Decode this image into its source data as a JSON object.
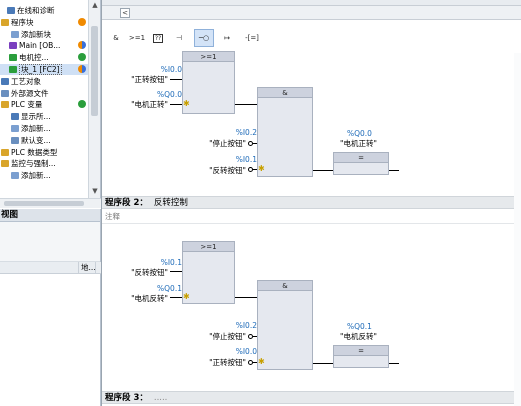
{
  "tree": {
    "items": [
      {
        "label": "在线和诊断",
        "icon": "diagnostics-icon",
        "indent": 6,
        "color": "#4a7ab8"
      },
      {
        "label": "程序块",
        "icon": "folder-icon",
        "indent": 0,
        "color": "#d9a52b",
        "status": "#f08a00"
      },
      {
        "label": "添加新块",
        "icon": "add-block-icon",
        "indent": 10,
        "color": "#7b9fd0"
      },
      {
        "label": "Main [OB...",
        "icon": "ob-block-icon",
        "indent": 8,
        "color": "#7a3fbf",
        "status": "split"
      },
      {
        "label": "电机控...",
        "icon": "fb-block-icon",
        "indent": 8,
        "color": "#2a9e3c",
        "status": "#2a9e3c"
      },
      {
        "label": "块_1 [FC2]",
        "icon": "fc-block-icon",
        "indent": 8,
        "color": "#2a9e3c",
        "status": "split",
        "selected": true
      },
      {
        "label": "工艺对象",
        "icon": "technology-icon",
        "indent": 0,
        "color": "#4a7ab8"
      },
      {
        "label": "外部源文件",
        "icon": "source-file-icon",
        "indent": 0,
        "color": "#6a8fbf"
      },
      {
        "label": "PLC 变量",
        "icon": "tag-table-icon",
        "indent": 0,
        "color": "#d9a52b",
        "status": "#2a9e3c"
      },
      {
        "label": "显示所...",
        "icon": "show-all-icon",
        "indent": 10,
        "color": "#4a7ab8"
      },
      {
        "label": "添加新...",
        "icon": "add-table-icon",
        "indent": 10,
        "color": "#7b9fd0"
      },
      {
        "label": "默认变...",
        "icon": "default-table-icon",
        "indent": 10,
        "color": "#6a8fbf"
      },
      {
        "label": "PLC 数据类型",
        "icon": "data-type-icon",
        "indent": 0,
        "color": "#d9a52b"
      },
      {
        "label": "监控与强制...",
        "icon": "watch-table-icon",
        "indent": 0,
        "color": "#d9a52b"
      },
      {
        "label": "添加新...",
        "icon": "add-watch-icon",
        "indent": 10,
        "color": "#7b9fd0"
      }
    ]
  },
  "details": {
    "title": "视图",
    "col2": "地..."
  },
  "toolbar": {
    "buttons": [
      {
        "label": "&",
        "name": "and-box-button"
      },
      {
        "label": ">=1",
        "name": "or-box-button"
      },
      {
        "label": "??",
        "name": "empty-box-button"
      },
      {
        "label": "⊣",
        "name": "branch-open-button"
      },
      {
        "label": "─○",
        "name": "negate-button",
        "active": true
      },
      {
        "label": "↦",
        "name": "assignment-button"
      },
      {
        "label": "-[=]",
        "name": "coil-button"
      }
    ]
  },
  "network2": {
    "title": "程序段 2：",
    "name": "反转控制"
  },
  "network2_comment": "注释",
  "network1": {
    "or_label": ">=1",
    "and_label": "&",
    "assign_label": "=",
    "in1_addr": "%I0.0",
    "in1_sym": "\"正转按钮\"",
    "in2_addr": "%Q0.0",
    "in2_sym": "\"电机正转\"",
    "in3_addr": "%I0.2",
    "in3_sym": "\"停止按钮\"",
    "in4_addr": "%I0.1",
    "in4_sym": "\"反转按钮\"",
    "out_addr": "%Q0.0",
    "out_sym": "\"电机正转\""
  },
  "network2_logic": {
    "or_label": ">=1",
    "and_label": "&",
    "assign_label": "=",
    "in1_addr": "%I0.1",
    "in1_sym": "\"反转按钮\"",
    "in2_addr": "%Q0.1",
    "in2_sym": "\"电机反转\"",
    "in3_addr": "%I0.2",
    "in3_sym": "\"停止按钮\"",
    "in4_addr": "%I0.0",
    "in4_sym": "\"正转按钮\"",
    "out_addr": "%Q0.1",
    "out_sym": "\"电机反转\""
  },
  "network3": {
    "title": "程序段 3：",
    "name": "....."
  }
}
